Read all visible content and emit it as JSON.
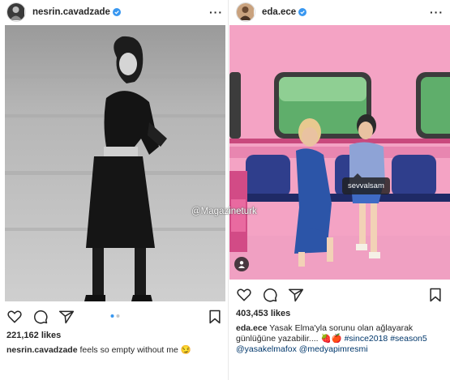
{
  "posts": [
    {
      "username": "nesrin.cavadzade",
      "likes": "221,162 likes",
      "caption_user": "nesrin.cavadzade",
      "caption_text": "feels so empty without me",
      "caption_emoji": "😏"
    },
    {
      "username": "eda.ece",
      "likes": "403,453 likes",
      "caption_user": "eda.ece",
      "caption_text": "Yasak Elma'yla sorunu olan ağlayarak günlüğüne yazabilir.... 🍓🍎",
      "hashtags": "#since2018 #season5",
      "mentions": "@yasakelmafox @medyapimresmi",
      "tooltip": "sevvalsam"
    }
  ],
  "watermark": "@Magazineturk",
  "icons": [
    "verified-badge-icon",
    "more-options-icon",
    "heart-icon",
    "comment-icon",
    "share-icon",
    "bookmark-icon",
    "user-tag-icon"
  ],
  "colors": {
    "verified": "#3897f0",
    "link": "#00376b",
    "pink_wall": "#f4a3c4"
  }
}
